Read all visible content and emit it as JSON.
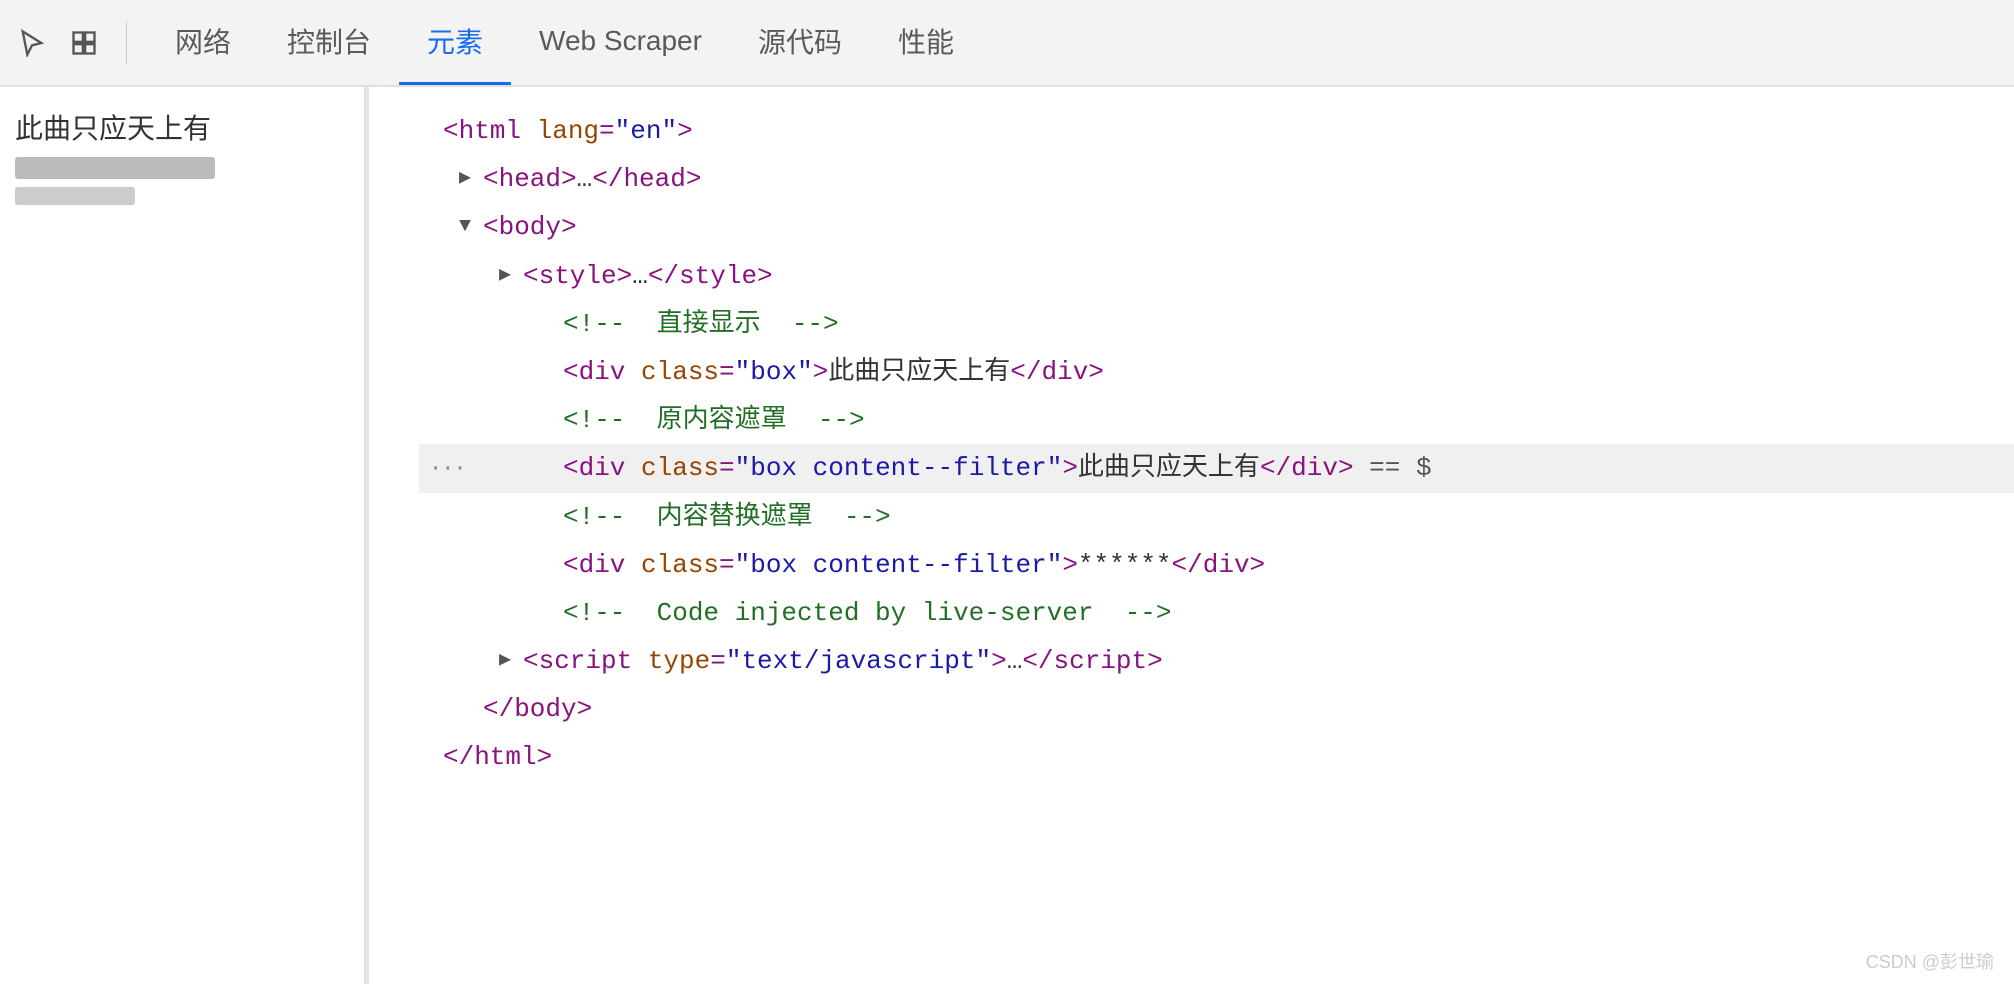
{
  "toolbar": {
    "tabs": [
      {
        "id": "tab-network",
        "label": "网络",
        "active": false
      },
      {
        "id": "tab-console",
        "label": "控制台",
        "active": false
      },
      {
        "id": "tab-elements",
        "label": "元素",
        "active": true
      },
      {
        "id": "tab-webscraper",
        "label": "Web Scraper",
        "active": false
      },
      {
        "id": "tab-sources",
        "label": "源代码",
        "active": false
      },
      {
        "id": "tab-performance",
        "label": "性能",
        "active": false
      }
    ]
  },
  "left_panel": {
    "title": "此曲只应天上有",
    "subtitle_blurred": "████████████",
    "sub2_blurred": "████████"
  },
  "code": {
    "lines": [
      {
        "indent": 0,
        "arrow": "none",
        "content": "<html lang=\"en\">"
      },
      {
        "indent": 1,
        "arrow": "collapsed",
        "content": "<head>…</head>"
      },
      {
        "indent": 1,
        "arrow": "expanded",
        "content": "<body>"
      },
      {
        "indent": 2,
        "arrow": "collapsed",
        "content": "<style>…</style>"
      },
      {
        "indent": 3,
        "arrow": "none",
        "content": "<!-- 直接显示 -->"
      },
      {
        "indent": 3,
        "arrow": "none",
        "content": "<div class=\"box\">此曲只应天上有</div>"
      },
      {
        "indent": 3,
        "arrow": "none",
        "content": "<!-- 原内容遮罩 -->"
      },
      {
        "indent": 3,
        "arrow": "none",
        "content": "<div class=\"box content--filter\">此曲只应天上有</div> == $",
        "highlighted": true,
        "has_dots": true
      },
      {
        "indent": 3,
        "arrow": "none",
        "content": "<!-- 内容替换遮罩 -->"
      },
      {
        "indent": 3,
        "arrow": "none",
        "content": "<div class=\"box content--filter\">******</div>"
      },
      {
        "indent": 3,
        "arrow": "none",
        "content": "<!-- Code injected by live-server -->"
      },
      {
        "indent": 2,
        "arrow": "collapsed",
        "content": "<script type=\"text/javascript\">…<\\/script>"
      },
      {
        "indent": 1,
        "arrow": "none",
        "content": "</body>"
      },
      {
        "indent": 0,
        "arrow": "none",
        "content": "</html>"
      }
    ]
  },
  "watermark": {
    "text": "CSDN @彭世瑜"
  },
  "icons": {
    "cursor_icon": "↖",
    "layers_icon": "⬜"
  }
}
